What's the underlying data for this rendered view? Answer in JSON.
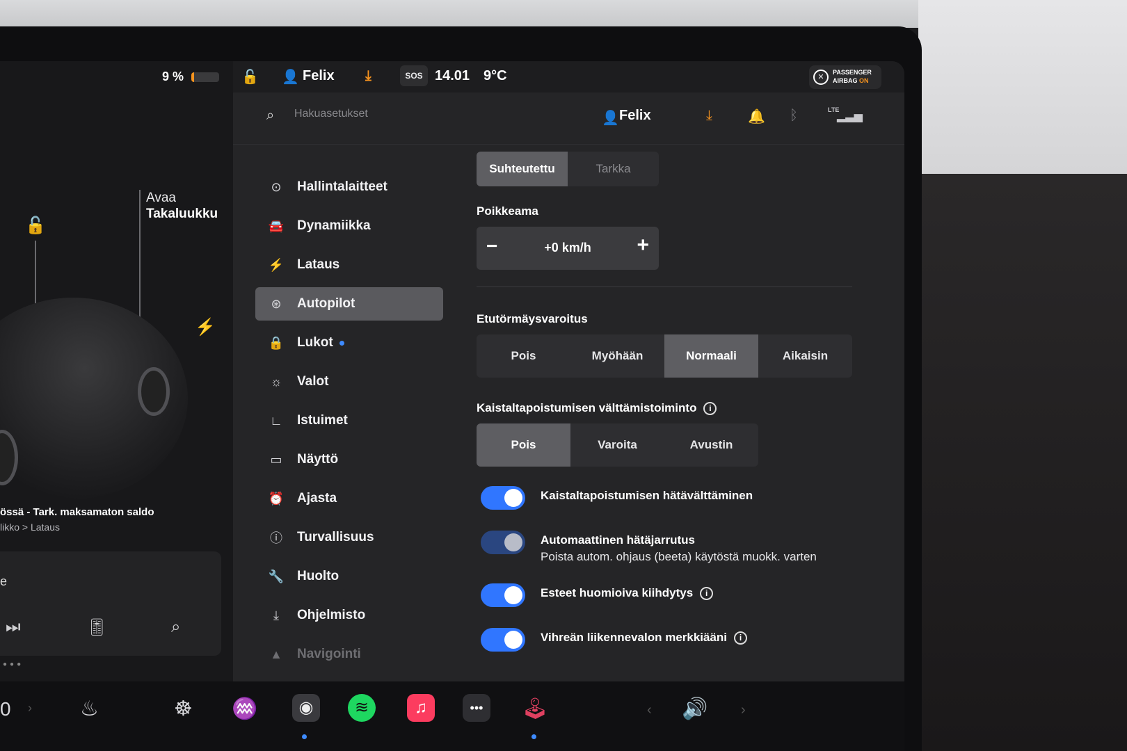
{
  "car": {
    "battery_percent": "9 %",
    "battery_level": 0.09,
    "trunk_label_top": "Avaa",
    "trunk_label_bottom": "Takaluukku",
    "notice": "össä - Tark. maksamaton saldo",
    "notice_sub": "likko > Lataus",
    "media_text": "e"
  },
  "status": {
    "user": "Felix",
    "sos": "SOS",
    "time": "14.01",
    "temperature": "9°C",
    "airbag_line1": "PASSENGER",
    "airbag_line2": "AIRBAG",
    "airbag_state": "ON"
  },
  "header": {
    "search_placeholder": "Hakuasetukset",
    "user": "Felix",
    "lte": "LTE"
  },
  "menu": [
    {
      "label": "Hallintalaitteet",
      "icon": "toggle-icon"
    },
    {
      "label": "Dynamiikka",
      "icon": "car-icon"
    },
    {
      "label": "Lataus",
      "icon": "bolt-icon"
    },
    {
      "label": "Autopilot",
      "icon": "steering-wheel-icon",
      "active": true
    },
    {
      "label": "Lukot",
      "icon": "lock-icon",
      "dot": true
    },
    {
      "label": "Valot",
      "icon": "sun-icon"
    },
    {
      "label": "Istuimet",
      "icon": "seat-icon"
    },
    {
      "label": "Näyttö",
      "icon": "display-icon"
    },
    {
      "label": "Ajasta",
      "icon": "alarm-clock-icon"
    },
    {
      "label": "Turvallisuus",
      "icon": "alert-circle-icon"
    },
    {
      "label": "Huolto",
      "icon": "wrench-icon"
    },
    {
      "label": "Ohjelmisto",
      "icon": "download-icon"
    },
    {
      "label": "Navigointi",
      "icon": "navigation-icon"
    }
  ],
  "speed_mode": {
    "options": [
      "Suhteutettu",
      "Tarkka"
    ],
    "selected": "Suhteutettu"
  },
  "offset": {
    "title": "Poikkeama",
    "value": "+0 km/h",
    "minus": "−",
    "plus": "+"
  },
  "forward_collision": {
    "title": "Etutörmäysvaroitus",
    "options": [
      "Pois",
      "Myöhään",
      "Normaali",
      "Aikaisin"
    ],
    "selected": "Normaali"
  },
  "lane_departure": {
    "title": "Kaistaltapoistumisen välttämistoiminto",
    "options": [
      "Pois",
      "Varoita",
      "Avustin"
    ],
    "selected": "Pois"
  },
  "toggles": [
    {
      "label": "Kaistaltapoistumisen hätävälttäminen",
      "on": true
    },
    {
      "label": "Automaattinen hätäjarrutus",
      "sub": "Poista autom. ohjaus (beeta) käytöstä muokk. varten",
      "on": true,
      "disabled": true
    },
    {
      "label": "Esteet huomioiva kiihdytys",
      "on": true,
      "info": true
    },
    {
      "label": "Vihreän liikennevalon merkkiääni",
      "on": true,
      "info": true
    }
  ],
  "dock": {
    "left_value": "0",
    "apps": [
      "seat-heater-icon",
      "steering-heat-icon",
      "defrost-icon",
      "camera-icon",
      "spotify-icon",
      "music-icon",
      "more-icon",
      "joystick-icon",
      "volume-icon"
    ]
  },
  "colors": {
    "accent_blue": "#3076ff",
    "warning_orange": "#f7931e",
    "spotify_green": "#1ed760",
    "music_pink": "#fc3c5f"
  }
}
